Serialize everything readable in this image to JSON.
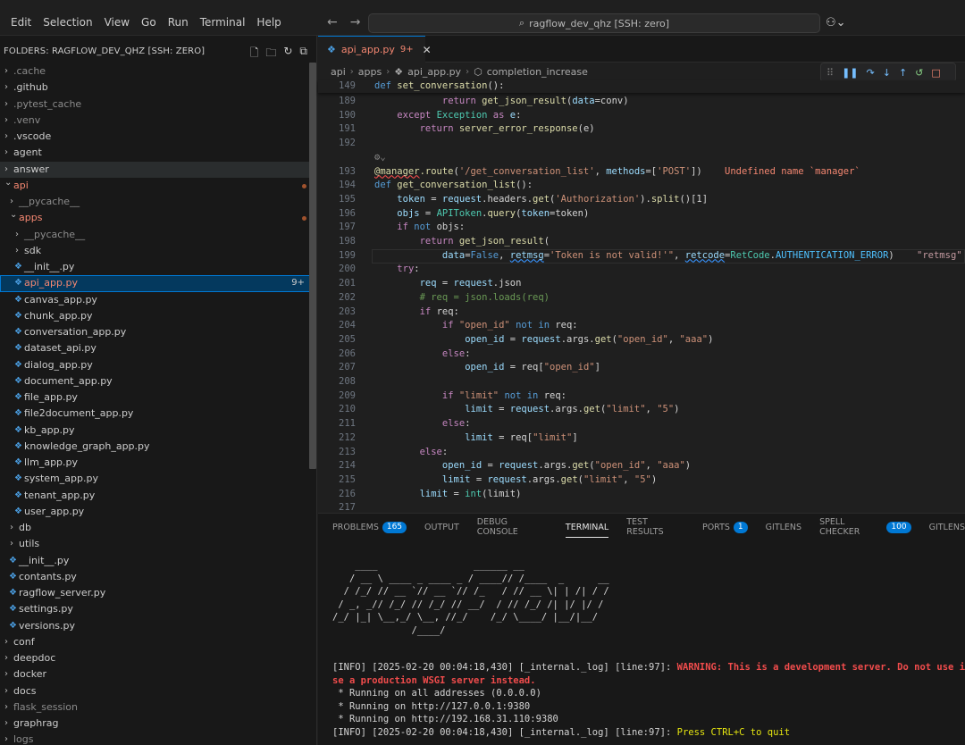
{
  "menu": [
    "Edit",
    "Selection",
    "View",
    "Go",
    "Run",
    "Terminal",
    "Help"
  ],
  "command_center": {
    "text": "ragflow_dev_qhz [SSH: zero]"
  },
  "explorer": {
    "title": "FOLDERS: RAGFLOW_DEV_QHZ [SSH: ZERO]",
    "items": [
      {
        "label": ".cache",
        "depth": 0,
        "kind": "folder",
        "dim": true
      },
      {
        "label": ".github",
        "depth": 0,
        "kind": "folder"
      },
      {
        "label": ".pytest_cache",
        "depth": 0,
        "kind": "folder",
        "dim": true
      },
      {
        "label": ".venv",
        "depth": 0,
        "kind": "folder",
        "dim": true
      },
      {
        "label": ".vscode",
        "depth": 0,
        "kind": "folder"
      },
      {
        "label": "agent",
        "depth": 0,
        "kind": "folder"
      },
      {
        "label": "answer",
        "depth": 0,
        "kind": "folder",
        "highlight": true
      },
      {
        "label": "api",
        "depth": 0,
        "kind": "folder-open",
        "error": true,
        "dot": true
      },
      {
        "label": "__pycache__",
        "depth": 1,
        "kind": "folder",
        "dim": true
      },
      {
        "label": "apps",
        "depth": 1,
        "kind": "folder-open",
        "error": true,
        "dot": true
      },
      {
        "label": "__pycache__",
        "depth": 2,
        "kind": "folder",
        "dim": true
      },
      {
        "label": "sdk",
        "depth": 2,
        "kind": "folder"
      },
      {
        "label": "__init__.py",
        "depth": 2,
        "kind": "file"
      },
      {
        "label": "api_app.py",
        "depth": 2,
        "kind": "file",
        "selected": true,
        "badge": "9+"
      },
      {
        "label": "canvas_app.py",
        "depth": 2,
        "kind": "file"
      },
      {
        "label": "chunk_app.py",
        "depth": 2,
        "kind": "file"
      },
      {
        "label": "conversation_app.py",
        "depth": 2,
        "kind": "file"
      },
      {
        "label": "dataset_api.py",
        "depth": 2,
        "kind": "file"
      },
      {
        "label": "dialog_app.py",
        "depth": 2,
        "kind": "file"
      },
      {
        "label": "document_app.py",
        "depth": 2,
        "kind": "file"
      },
      {
        "label": "file_app.py",
        "depth": 2,
        "kind": "file"
      },
      {
        "label": "file2document_app.py",
        "depth": 2,
        "kind": "file"
      },
      {
        "label": "kb_app.py",
        "depth": 2,
        "kind": "file"
      },
      {
        "label": "knowledge_graph_app.py",
        "depth": 2,
        "kind": "file"
      },
      {
        "label": "llm_app.py",
        "depth": 2,
        "kind": "file"
      },
      {
        "label": "system_app.py",
        "depth": 2,
        "kind": "file"
      },
      {
        "label": "tenant_app.py",
        "depth": 2,
        "kind": "file"
      },
      {
        "label": "user_app.py",
        "depth": 2,
        "kind": "file"
      },
      {
        "label": "db",
        "depth": 1,
        "kind": "folder"
      },
      {
        "label": "utils",
        "depth": 1,
        "kind": "folder"
      },
      {
        "label": "__init__.py",
        "depth": 1,
        "kind": "file"
      },
      {
        "label": "contants.py",
        "depth": 1,
        "kind": "file"
      },
      {
        "label": "ragflow_server.py",
        "depth": 1,
        "kind": "file"
      },
      {
        "label": "settings.py",
        "depth": 1,
        "kind": "file"
      },
      {
        "label": "versions.py",
        "depth": 1,
        "kind": "file"
      },
      {
        "label": "conf",
        "depth": 0,
        "kind": "folder"
      },
      {
        "label": "deepdoc",
        "depth": 0,
        "kind": "folder"
      },
      {
        "label": "docker",
        "depth": 0,
        "kind": "folder"
      },
      {
        "label": "docs",
        "depth": 0,
        "kind": "folder"
      },
      {
        "label": "flask_session",
        "depth": 0,
        "kind": "folder",
        "dim": true
      },
      {
        "label": "graphrag",
        "depth": 0,
        "kind": "folder"
      },
      {
        "label": "logs",
        "depth": 0,
        "kind": "folder",
        "dim": true
      }
    ]
  },
  "editor": {
    "tab": {
      "label": "api_app.py",
      "badge": "9+"
    },
    "breadcrumb": [
      "api",
      "apps",
      "api_app.py",
      "completion_increase"
    ],
    "sticky": {
      "ln": "149",
      "code": "def set_conversation():"
    },
    "lines": [
      {
        "ln": "189",
        "indent": 3,
        "tokens": [
          [
            "kw2",
            "return "
          ],
          [
            "fn",
            "get_json_result"
          ],
          [
            "",
            "("
          ],
          [
            "var",
            "data"
          ],
          [
            "",
            "=conv)"
          ]
        ]
      },
      {
        "ln": "190",
        "indent": 1,
        "tokens": [
          [
            "kw2",
            "except "
          ],
          [
            "cls",
            "Exception"
          ],
          [
            "kw2",
            " as "
          ],
          [
            "var",
            "e"
          ],
          [
            "",
            ":"
          ]
        ]
      },
      {
        "ln": "191",
        "indent": 2,
        "tokens": [
          [
            "kw2",
            "return "
          ],
          [
            "fn",
            "server_error_response"
          ],
          [
            "",
            "(e)"
          ]
        ]
      },
      {
        "ln": "192",
        "indent": 0,
        "tokens": []
      },
      {
        "ln": "",
        "indent": 0,
        "tokens": [
          [
            "ln",
            "⚙⌄"
          ]
        ]
      },
      {
        "ln": "193",
        "indent": 0,
        "tokens": [
          [
            "fn squigr",
            "@manager"
          ],
          [
            "fn",
            ".route"
          ],
          [
            "",
            "("
          ],
          [
            "str",
            "'/get_conversation_list'"
          ],
          [
            "",
            ", "
          ],
          [
            "var",
            "methods"
          ],
          [
            "",
            "=["
          ],
          [
            "str",
            "'POST'"
          ],
          [
            "",
            "])"
          ],
          [
            "diag",
            "    Undefined name `manager`"
          ]
        ]
      },
      {
        "ln": "194",
        "indent": 0,
        "tokens": [
          [
            "kw",
            "def "
          ],
          [
            "fn",
            "get_conversation_list"
          ],
          [
            "",
            "():"
          ]
        ]
      },
      {
        "ln": "195",
        "indent": 1,
        "tokens": [
          [
            "var",
            "token"
          ],
          [
            "",
            " = "
          ],
          [
            "var",
            "request"
          ],
          [
            "",
            ".headers."
          ],
          [
            "fn",
            "get"
          ],
          [
            "",
            "("
          ],
          [
            "str",
            "'Authorization'"
          ],
          [
            "",
            ")."
          ],
          [
            "fn",
            "split"
          ],
          [
            "",
            "()[1]"
          ]
        ]
      },
      {
        "ln": "196",
        "indent": 1,
        "tokens": [
          [
            "var",
            "objs"
          ],
          [
            "",
            " = "
          ],
          [
            "cls",
            "APIToken"
          ],
          [
            "",
            "."
          ],
          [
            "fn",
            "query"
          ],
          [
            "",
            "("
          ],
          [
            "var",
            "token"
          ],
          [
            "",
            "=token)"
          ]
        ]
      },
      {
        "ln": "197",
        "indent": 1,
        "tokens": [
          [
            "kw2",
            "if "
          ],
          [
            "kw",
            "not "
          ],
          [
            "",
            "objs:"
          ]
        ]
      },
      {
        "ln": "198",
        "indent": 2,
        "tokens": [
          [
            "kw2",
            "return "
          ],
          [
            "fn",
            "get_json_result"
          ],
          [
            "",
            "("
          ]
        ]
      },
      {
        "ln": "199",
        "indent": 3,
        "current": true,
        "tokens": [
          [
            "var",
            "data"
          ],
          [
            "",
            "="
          ],
          [
            "kw",
            "False"
          ],
          [
            "",
            ", "
          ],
          [
            "var squig",
            "retmsg"
          ],
          [
            "",
            "="
          ],
          [
            "str",
            "'Token is not valid!'\""
          ],
          [
            "",
            ", "
          ],
          [
            "var squig",
            "retcode"
          ],
          [
            "",
            "="
          ],
          [
            "cls",
            "RetCode"
          ],
          [
            "",
            "."
          ],
          [
            "cst",
            "AUTHENTICATION_ERROR"
          ],
          [
            "",
            ")"
          ],
          [
            "diag2",
            "    \"retmsg\""
          ]
        ]
      },
      {
        "ln": "200",
        "indent": 1,
        "tokens": [
          [
            "kw2",
            "try"
          ],
          [
            "",
            ":"
          ]
        ]
      },
      {
        "ln": "201",
        "indent": 2,
        "tokens": [
          [
            "var",
            "req"
          ],
          [
            "",
            " = "
          ],
          [
            "var",
            "request"
          ],
          [
            "",
            ".json"
          ]
        ]
      },
      {
        "ln": "202",
        "indent": 2,
        "tokens": [
          [
            "cmt",
            "# req = json.loads(req)"
          ]
        ]
      },
      {
        "ln": "203",
        "indent": 2,
        "tokens": [
          [
            "kw2",
            "if "
          ],
          [
            "",
            "req:"
          ]
        ]
      },
      {
        "ln": "204",
        "indent": 3,
        "tokens": [
          [
            "kw2",
            "if "
          ],
          [
            "str",
            "\"open_id\""
          ],
          [
            "kw",
            " not in "
          ],
          [
            "",
            "req:"
          ]
        ]
      },
      {
        "ln": "205",
        "indent": 4,
        "tokens": [
          [
            "var",
            "open_id"
          ],
          [
            "",
            " = "
          ],
          [
            "var",
            "request"
          ],
          [
            "",
            ".args."
          ],
          [
            "fn",
            "get"
          ],
          [
            "",
            "("
          ],
          [
            "str",
            "\"open_id\""
          ],
          [
            "",
            ", "
          ],
          [
            "str",
            "\"aaa\""
          ],
          [
            "",
            ")"
          ]
        ]
      },
      {
        "ln": "206",
        "indent": 3,
        "tokens": [
          [
            "kw2",
            "else"
          ],
          [
            "",
            ":"
          ]
        ]
      },
      {
        "ln": "207",
        "indent": 4,
        "tokens": [
          [
            "var",
            "open_id"
          ],
          [
            "",
            " = req["
          ],
          [
            "str",
            "\"open_id\""
          ],
          [
            "",
            "]"
          ]
        ]
      },
      {
        "ln": "208",
        "indent": 0,
        "tokens": []
      },
      {
        "ln": "209",
        "indent": 3,
        "tokens": [
          [
            "kw2",
            "if "
          ],
          [
            "str",
            "\"limit\""
          ],
          [
            "kw",
            " not in "
          ],
          [
            "",
            "req:"
          ]
        ]
      },
      {
        "ln": "210",
        "indent": 4,
        "tokens": [
          [
            "var",
            "limit"
          ],
          [
            "",
            " = "
          ],
          [
            "var",
            "request"
          ],
          [
            "",
            ".args."
          ],
          [
            "fn",
            "get"
          ],
          [
            "",
            "("
          ],
          [
            "str",
            "\"limit\""
          ],
          [
            "",
            ", "
          ],
          [
            "str",
            "\"5\""
          ],
          [
            "",
            ")"
          ]
        ]
      },
      {
        "ln": "211",
        "indent": 3,
        "tokens": [
          [
            "kw2",
            "else"
          ],
          [
            "",
            ":"
          ]
        ]
      },
      {
        "ln": "212",
        "indent": 4,
        "tokens": [
          [
            "var",
            "limit"
          ],
          [
            "",
            " = req["
          ],
          [
            "str",
            "\"limit\""
          ],
          [
            "",
            "]"
          ]
        ]
      },
      {
        "ln": "213",
        "indent": 2,
        "tokens": [
          [
            "kw2",
            "else"
          ],
          [
            "",
            ":"
          ]
        ]
      },
      {
        "ln": "214",
        "indent": 3,
        "tokens": [
          [
            "var",
            "open_id"
          ],
          [
            "",
            " = "
          ],
          [
            "var",
            "request"
          ],
          [
            "",
            ".args."
          ],
          [
            "fn",
            "get"
          ],
          [
            "",
            "("
          ],
          [
            "str",
            "\"open_id\""
          ],
          [
            "",
            ", "
          ],
          [
            "str",
            "\"aaa\""
          ],
          [
            "",
            ")"
          ]
        ]
      },
      {
        "ln": "215",
        "indent": 3,
        "tokens": [
          [
            "var",
            "limit"
          ],
          [
            "",
            " = "
          ],
          [
            "var",
            "request"
          ],
          [
            "",
            ".args."
          ],
          [
            "fn",
            "get"
          ],
          [
            "",
            "("
          ],
          [
            "str",
            "\"limit\""
          ],
          [
            "",
            ", "
          ],
          [
            "str",
            "\"5\""
          ],
          [
            "",
            ")"
          ]
        ]
      },
      {
        "ln": "216",
        "indent": 2,
        "tokens": [
          [
            "var",
            "limit"
          ],
          [
            "",
            " = "
          ],
          [
            "cls",
            "int"
          ],
          [
            "",
            "(limit)"
          ]
        ]
      },
      {
        "ln": "217",
        "indent": 0,
        "tokens": []
      }
    ]
  },
  "panel": {
    "tabs": [
      {
        "label": "PROBLEMS",
        "badge": "165"
      },
      {
        "label": "OUTPUT"
      },
      {
        "label": "DEBUG CONSOLE"
      },
      {
        "label": "TERMINAL",
        "active": true
      },
      {
        "label": "TEST RESULTS"
      },
      {
        "label": "PORTS",
        "badge": "1"
      },
      {
        "label": "GITLENS"
      },
      {
        "label": "SPELL CHECKER",
        "badge": "100"
      },
      {
        "label": "GITLENS"
      }
    ],
    "terminal": {
      "ascii": [
        "    ____                 ______ __",
        "   / __ \\ ____ _ ____ _ / ____// /____  _      __",
        "  / /_/ // __ `// __ `// /_   / // __ \\| | /| / /",
        " / _, _// /_/ // /_/ // __/  / // /_/ /| |/ |/ /",
        "/_/ |_| \\__,_/ \\__, //_/    /_/ \\____/ |__/|__/",
        "              /____/"
      ],
      "log1_prefix": "[INFO] [2025-02-20 00:04:18,430] [_internal._log] [line:97]: ",
      "log1_warn": "WARNING: This is a development server. Do not use it in",
      "log1_warn2": "se a production WSGI server instead.",
      "running": [
        " * Running on all addresses (0.0.0.0)",
        " * Running on http://127.0.0.1:9380",
        " * Running on http://192.168.31.110:9380"
      ],
      "log2_prefix": "[INFO] [2025-02-20 00:04:18,430] [_internal._log] [line:97]: ",
      "log2_msg": "Press CTRL+C to quit"
    }
  }
}
